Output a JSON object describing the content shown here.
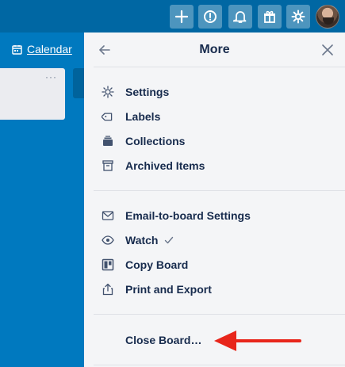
{
  "header": {
    "buttons": [
      {
        "icon": "plus-icon"
      },
      {
        "icon": "info-icon"
      },
      {
        "icon": "bell-icon"
      },
      {
        "icon": "gift-icon"
      },
      {
        "icon": "gear-icon"
      }
    ],
    "avatar_icon": "user-avatar"
  },
  "board": {
    "calendar_label": "Calendar",
    "list_menu": "···"
  },
  "panel": {
    "title": "More",
    "sections": [
      {
        "items": [
          {
            "label": "Settings",
            "icon": "gear-icon"
          },
          {
            "label": "Labels",
            "icon": "tag-icon"
          },
          {
            "label": "Collections",
            "icon": "collections-icon"
          },
          {
            "label": "Archived Items",
            "icon": "archive-icon"
          }
        ]
      },
      {
        "items": [
          {
            "label": "Email-to-board Settings",
            "icon": "email-icon"
          },
          {
            "label": "Watch",
            "icon": "eye-icon",
            "checked": true
          },
          {
            "label": "Copy Board",
            "icon": "board-icon"
          },
          {
            "label": "Print and Export",
            "icon": "share-icon"
          }
        ]
      },
      {
        "items": [
          {
            "label": "Close Board…",
            "icon": ""
          }
        ]
      }
    ]
  },
  "colors": {
    "board_bg": "#0079bf",
    "topbar_bg": "#0067a3",
    "panel_bg": "#f4f5f7",
    "annotation_arrow": "#e8261b"
  }
}
